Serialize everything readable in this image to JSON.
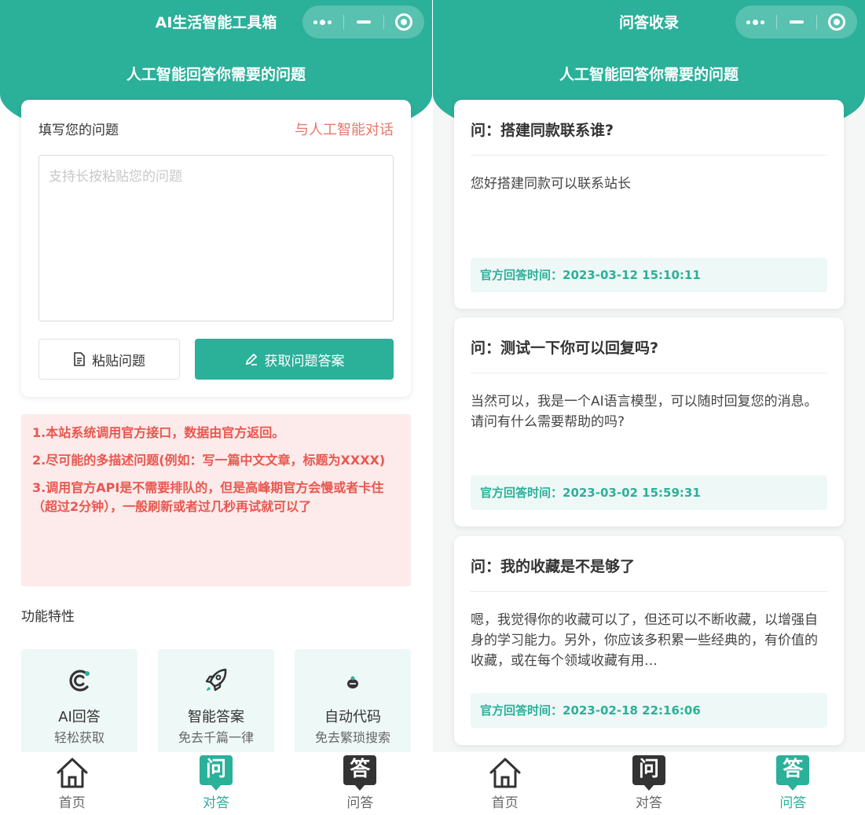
{
  "left": {
    "nav_title": "AI生活智能工具箱",
    "subtitle": "人工智能回答你需要的问题",
    "ask_label": "填写您的问题",
    "ask_link": "与人工智能对话",
    "ask_placeholder": "支持长按粘贴您的问题",
    "paste_button": "粘贴问题",
    "get_answer_button": "获取问题答案",
    "notices": [
      "1.本站系统调用官方接口，数据由官方返回。",
      "2.尽可能的多描述问题(例如：写一篇中文文章，标题为XXXX)",
      "3.调用官方API是不需要排队的，但是高峰期官方会慢或者卡住（超过2分钟），一般刷新或者过几秒再试就可以了"
    ],
    "features_title": "功能特性",
    "features": [
      {
        "name": "AI回答",
        "desc": "轻松获取",
        "icon": "ai-logo-icon"
      },
      {
        "name": "智能答案",
        "desc": "免去千篇一律",
        "icon": "rocket-icon"
      },
      {
        "name": "自动代码",
        "desc": "免去繁琐搜索",
        "icon": "code-icon"
      }
    ]
  },
  "right": {
    "nav_title": "问答收录",
    "subtitle": "人工智能回答你需要的问题",
    "records": [
      {
        "question": "问：搭建同款联系谁?",
        "answer": "您好搭建同款可以联系站长",
        "time": "官方回答时间：2023-03-12 15:10:11"
      },
      {
        "question": "问：测试一下你可以回复吗?",
        "answer": "当然可以，我是一个AI语言模型，可以随时回复您的消息。请问有什么需要帮助的吗?",
        "time": "官方回答时间：2023-03-02 15:59:31"
      },
      {
        "question": "问：我的收藏是不是够了",
        "answer": "嗯，我觉得你的收藏可以了，但还可以不断收藏，以增强自身的学习能力。另外，你应该多积累一些经典的，有价值的收藏，或在每个领域收藏有用…",
        "time": "官方回答时间：2023-02-18 22:16:06"
      }
    ]
  },
  "tabbar": {
    "home": "首页",
    "chat": "对答",
    "qa": "问答",
    "chat_glyph": "问",
    "qa_glyph": "答"
  },
  "colors": {
    "brand": "#2bb09a",
    "notice_text": "#e8574f",
    "notice_bg": "#fdeaea",
    "link": "#e8776a"
  }
}
